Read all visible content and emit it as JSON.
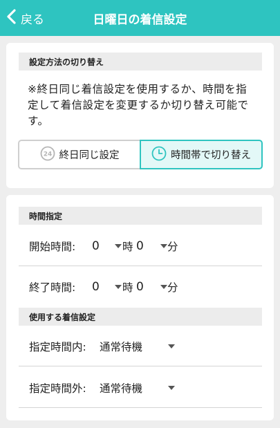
{
  "header": {
    "back_label": "戻る",
    "title": "日曜日の着信設定"
  },
  "mode_section": {
    "heading": "設定方法の切り替え",
    "note": "※終日同じ着信設定を使用するか、時間を指定して着信設定を変更するか切り替え可能です。",
    "options": [
      {
        "label": "終日同じ設定",
        "icon": "24h-icon",
        "selected": false
      },
      {
        "label": "時間帯で切り替え",
        "icon": "clock-icon",
        "selected": true
      }
    ]
  },
  "time_section": {
    "heading": "時間指定",
    "start": {
      "label": "開始時間:",
      "hour": "0",
      "hour_unit": "時",
      "minute": "0",
      "minute_unit": "分"
    },
    "end": {
      "label": "終了時間:",
      "hour": "0",
      "hour_unit": "時",
      "minute": "0",
      "minute_unit": "分"
    }
  },
  "ring_section": {
    "heading": "使用する着信設定",
    "inside": {
      "label": "指定時間内:",
      "value": "通常待機"
    },
    "outside": {
      "label": "指定時間外:",
      "value": "通常待機"
    }
  },
  "colors": {
    "accent": "#2ec4c0",
    "selected_bg": "#e3f8f7"
  }
}
